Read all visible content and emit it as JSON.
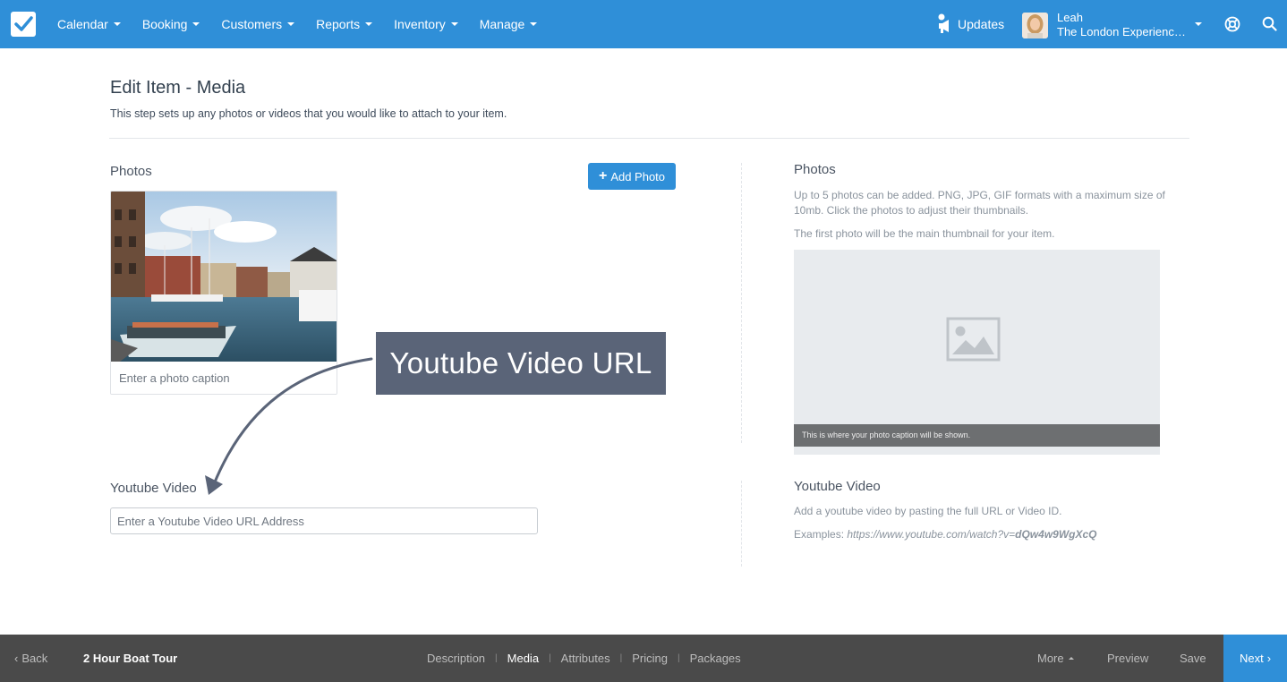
{
  "nav": {
    "items": [
      {
        "label": "Calendar"
      },
      {
        "label": "Booking"
      },
      {
        "label": "Customers"
      },
      {
        "label": "Reports"
      },
      {
        "label": "Inventory"
      },
      {
        "label": "Manage"
      }
    ],
    "updates_label": "Updates",
    "user_name": "Leah",
    "user_company": "The London Experienc…"
  },
  "page": {
    "title": "Edit Item - Media",
    "subtitle": "This step sets up any photos or videos that you would like to attach to your item."
  },
  "photos": {
    "label": "Photos",
    "add_button": "Add Photo",
    "caption_placeholder": "Enter a photo caption"
  },
  "photos_help": {
    "title": "Photos",
    "text1": "Up to 5 photos can be added. PNG, JPG, GIF formats with a maximum size of 10mb. Click the photos to adjust their thumbnails.",
    "text2": "The first photo will be the main thumbnail for your item.",
    "preview_caption": "This is where your photo caption will be shown."
  },
  "youtube": {
    "label": "Youtube Video",
    "placeholder": "Enter a Youtube Video URL Address"
  },
  "youtube_help": {
    "title": "Youtube Video",
    "text": "Add a youtube video by pasting the full URL or Video ID.",
    "examples_label": "Examples:",
    "example_url": "https://www.youtube.com/watch?v=",
    "example_id": "dQw4w9WgXcQ"
  },
  "callout": {
    "text": "Youtube Video URL"
  },
  "footer": {
    "back": "Back",
    "item_title": "2 Hour Boat Tour",
    "steps": [
      {
        "label": "Description"
      },
      {
        "label": "Media"
      },
      {
        "label": "Attributes"
      },
      {
        "label": "Pricing"
      },
      {
        "label": "Packages"
      }
    ],
    "separator": "|",
    "more": "More",
    "preview": "Preview",
    "save": "Save",
    "next": "Next"
  },
  "colors": {
    "brand": "#2f8fd8",
    "footer_bg": "#4a4a4a",
    "callout_bg": "#5a6478"
  }
}
